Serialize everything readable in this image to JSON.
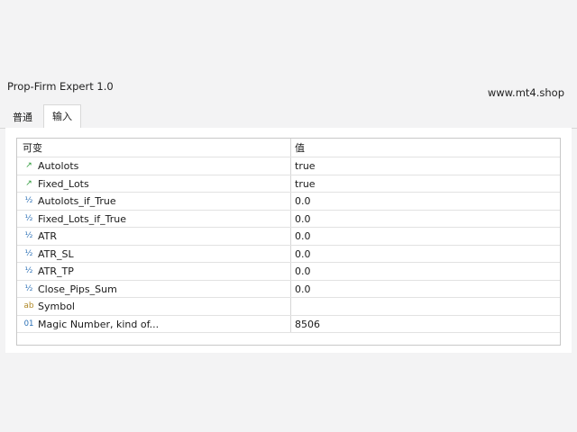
{
  "window": {
    "title": "Prop-Firm Expert 1.0",
    "site": "www.mt4.shop"
  },
  "tabs": [
    {
      "label": "普通"
    },
    {
      "label": "输入"
    }
  ],
  "table": {
    "headers": {
      "variable": "可变",
      "value": "值"
    },
    "rows": [
      {
        "type_icon": "bool-icon",
        "type_glyph": "↗",
        "name": "Autolots",
        "value": "true"
      },
      {
        "type_icon": "bool-icon",
        "type_glyph": "↗",
        "name": "Fixed_Lots",
        "value": "true"
      },
      {
        "type_icon": "double-icon",
        "type_glyph": "½",
        "name": "Autolots_if_True",
        "value": "0.0"
      },
      {
        "type_icon": "double-icon",
        "type_glyph": "½",
        "name": "Fixed_Lots_if_True",
        "value": "0.0"
      },
      {
        "type_icon": "double-icon",
        "type_glyph": "½",
        "name": "ATR",
        "value": "0.0"
      },
      {
        "type_icon": "double-icon",
        "type_glyph": "½",
        "name": "ATR_SL",
        "value": "0.0"
      },
      {
        "type_icon": "double-icon",
        "type_glyph": "½",
        "name": "ATR_TP",
        "value": "0.0"
      },
      {
        "type_icon": "double-icon",
        "type_glyph": "½",
        "name": "Close_Pips_Sum",
        "value": "0.0"
      },
      {
        "type_icon": "string-icon",
        "type_glyph": "ab",
        "name": "Symbol",
        "value": ""
      },
      {
        "type_icon": "int-icon",
        "type_glyph": "01",
        "name": "Magic Number, kind of...",
        "value": "8506"
      }
    ]
  }
}
